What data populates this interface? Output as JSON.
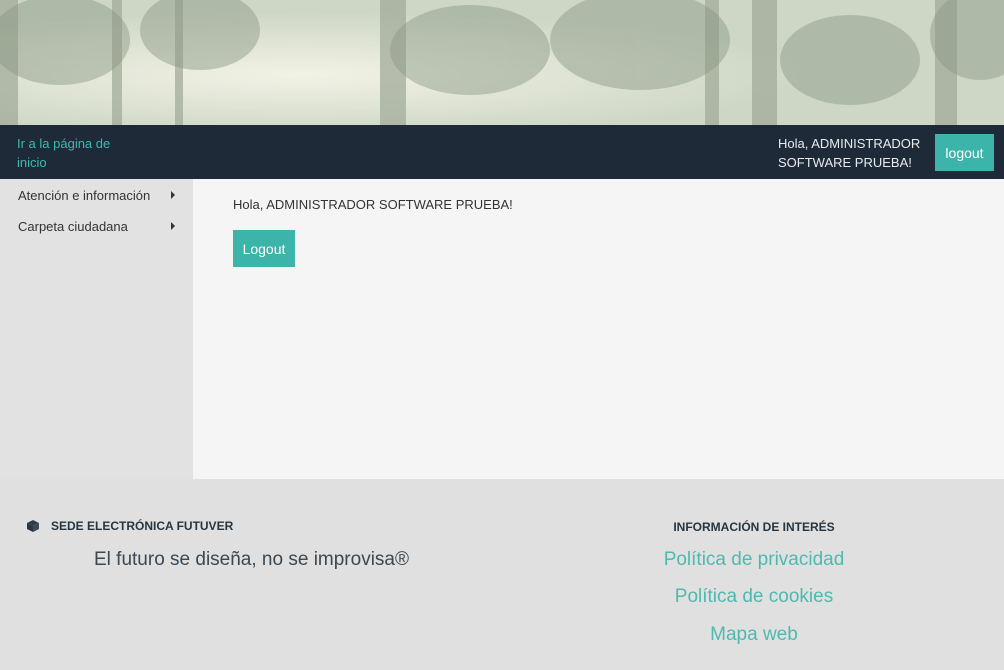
{
  "header": {
    "home_link": "Ir a la página de inicio",
    "greeting": "Hola, ADMINISTRADOR SOFTWARE PRUEBA!",
    "logout_label": "logout"
  },
  "sidebar": {
    "items": [
      {
        "label": "Atención e información"
      },
      {
        "label": "Carpeta ciudadana"
      }
    ]
  },
  "main": {
    "greeting": "Hola, ADMINISTRADOR SOFTWARE PRUEBA!",
    "logout_label": "Logout"
  },
  "footer": {
    "brand_title": "SEDE ELECTRÓNICA FUTUVER",
    "slogan": "El futuro se diseña, no se improvisa®",
    "interest_title": "INFORMACIÓN DE INTERÉS",
    "links": [
      "Política de privacidad",
      "Política de cookies",
      "Mapa web"
    ]
  },
  "colors": {
    "accent": "#3cb4aa",
    "topbar": "#1e2a38",
    "link": "#4dbab0"
  },
  "icons": {
    "brand": "cube-icon",
    "submenu": "caret-right-icon"
  }
}
